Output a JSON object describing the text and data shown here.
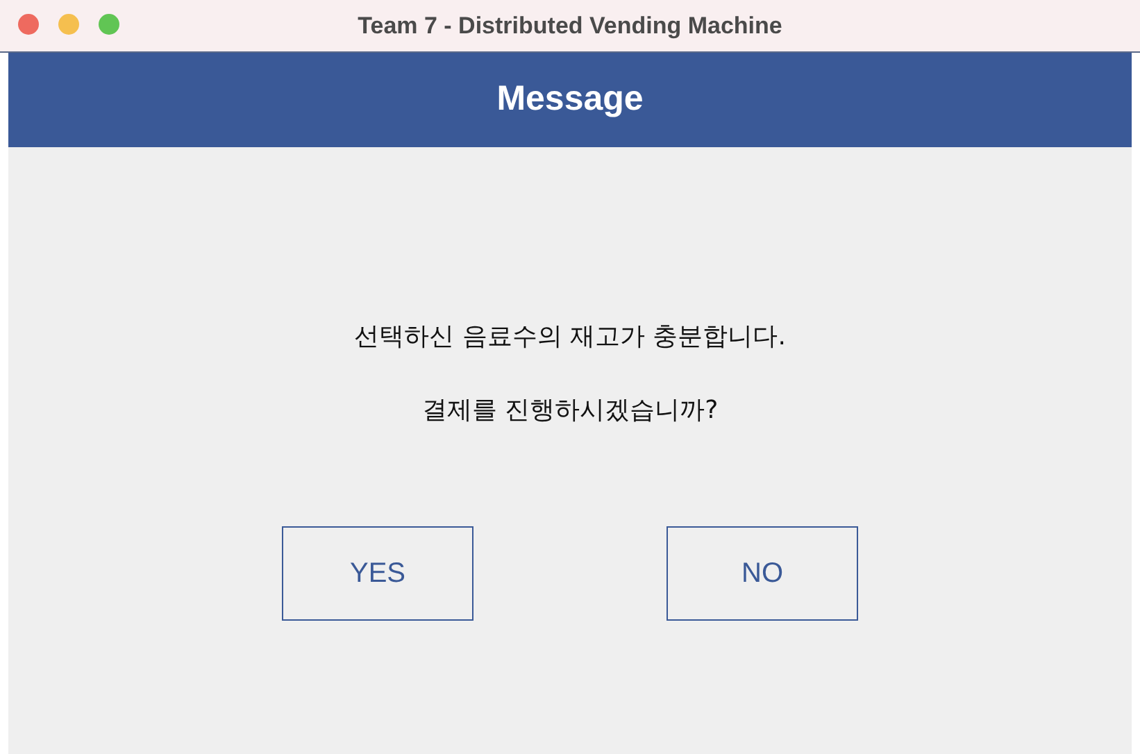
{
  "window": {
    "title": "Team 7 - Distributed Vending Machine"
  },
  "header": {
    "title": "Message"
  },
  "message": {
    "lines": [
      "선택하신 음료수의 재고가 충분합니다.",
      "결제를 진행하시겠습니까?"
    ]
  },
  "buttons": [
    "YES",
    "NO"
  ]
}
